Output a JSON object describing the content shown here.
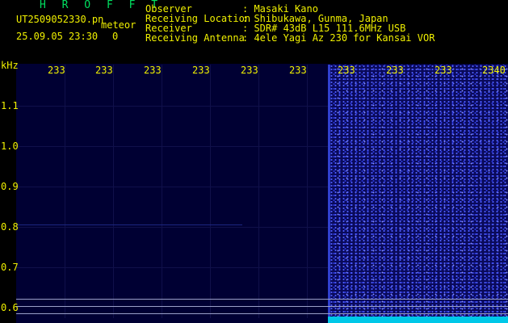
{
  "header": {
    "title": "H R O F F T",
    "filename": "UT2509052330.pn",
    "detect_label": "meteor",
    "date": "25.09.05 23:30",
    "count": "0"
  },
  "info": [
    {
      "label": "Observer",
      "value": ": Masaki Kano"
    },
    {
      "label": "Receiving Location",
      "value": ": Shibukawa, Gunma, Japan"
    },
    {
      "label": "Receiver",
      "value": ": SDR# 43dB L15 111.6MHz USB"
    },
    {
      "label": "Receiving Antenna",
      "value": ": 4ele Yagi Az 230 for Kansai VOR"
    }
  ],
  "axis": {
    "y_unit": "kHz",
    "x_ticks": [
      "233",
      "233",
      "233",
      "233",
      "233",
      "233",
      "233",
      "233",
      "233",
      "2340"
    ],
    "y_ticks": [
      "1.1",
      "1.0",
      "0.9",
      "0.8",
      "0.7",
      "0.6"
    ]
  },
  "colors": {
    "background": "#000033",
    "label_text": "#f0f000",
    "title_text": "#00e060"
  }
}
